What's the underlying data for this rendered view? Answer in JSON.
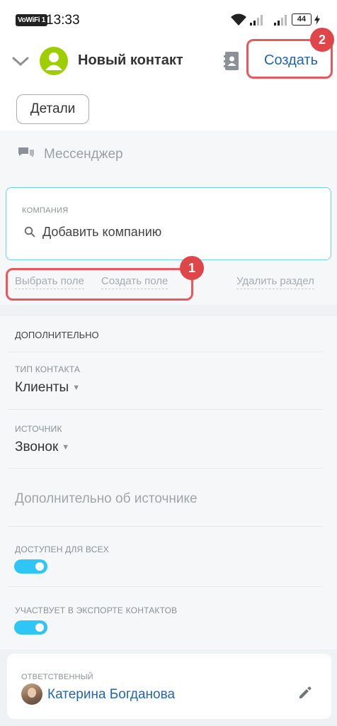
{
  "status": {
    "volte": "VoWiFi 1",
    "time": "13:33",
    "battery": "44"
  },
  "header": {
    "title": "Новый контакт",
    "create_label": "Создать",
    "details_label": "Детали",
    "badge_create": "2"
  },
  "form": {
    "messenger_label": "Мессенджер",
    "company": {
      "label": "КОМПАНИЯ",
      "add_placeholder": "Добавить компанию"
    },
    "actions": {
      "pick_field": "Выбрать поле",
      "create_field": "Создать поле",
      "delete_section": "Удалить раздел",
      "badge": "1"
    },
    "additional": {
      "title": "ДОПОЛНИТЕЛЬНО",
      "contact_type_label": "ТИП КОНТАКТА",
      "contact_type_value": "Клиенты",
      "source_label": "ИСТОЧНИК",
      "source_value": "Звонок",
      "source_info_placeholder": "Дополнительно об источнике",
      "available_all_label": "ДОСТУПЕН ДЛЯ ВСЕХ",
      "available_all_on": true,
      "export_label": "УЧАСТВУЕТ  В ЭКСПОРТЕ КОНТАКТОВ",
      "export_on": true
    },
    "responsible": {
      "label": "ОТВЕТСТВЕННЫЙ",
      "name": "Катерина Богданова"
    }
  },
  "colors": {
    "accent": "#2066b0",
    "toggle": "#2fc6f6",
    "highlight": "#e8585c",
    "avatar": "#9dcf00"
  }
}
